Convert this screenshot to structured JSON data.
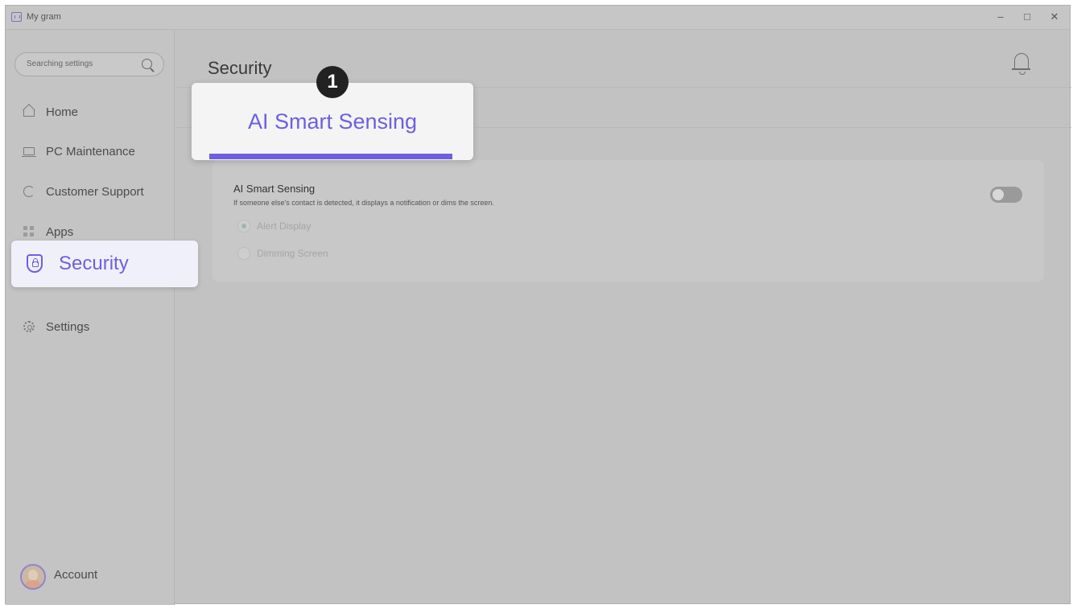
{
  "window": {
    "title": "My gram",
    "controls": {
      "minimize": "–",
      "maximize": "□",
      "close": "✕"
    }
  },
  "sidebar": {
    "search": {
      "placeholder": "Searching settings",
      "icon": "search-icon"
    },
    "items": [
      {
        "label": "Home",
        "icon": "home-icon"
      },
      {
        "label": "PC Maintenance",
        "icon": "laptop-icon"
      },
      {
        "label": "Customer Support",
        "icon": "headset-icon"
      },
      {
        "label": "Apps",
        "icon": "apps-grid-icon"
      },
      {
        "label": "Security",
        "icon": "shield-lock-icon",
        "selected": true
      },
      {
        "label": "Settings",
        "icon": "gear-icon"
      }
    ],
    "account": {
      "label": "Account",
      "icon": "avatar"
    }
  },
  "main": {
    "title": "Security",
    "notification_icon": "bell-icon",
    "tabs": [
      {
        "label": "AI Smart Sensing",
        "selected": true
      }
    ],
    "callout_badge": "1",
    "card": {
      "title": "AI Smart Sensing",
      "description": "If someone else's contact is detected, it displays a notification or dims the screen.",
      "toggle_on": false,
      "options": [
        {
          "label": "Alert Display",
          "selected": true
        },
        {
          "label": "Dimming Screen",
          "selected": false
        }
      ]
    }
  },
  "colors": {
    "accent": "#6d5fe0",
    "overlay_background": "#c2c2c2",
    "highlight_background": "#f4f4f4"
  }
}
